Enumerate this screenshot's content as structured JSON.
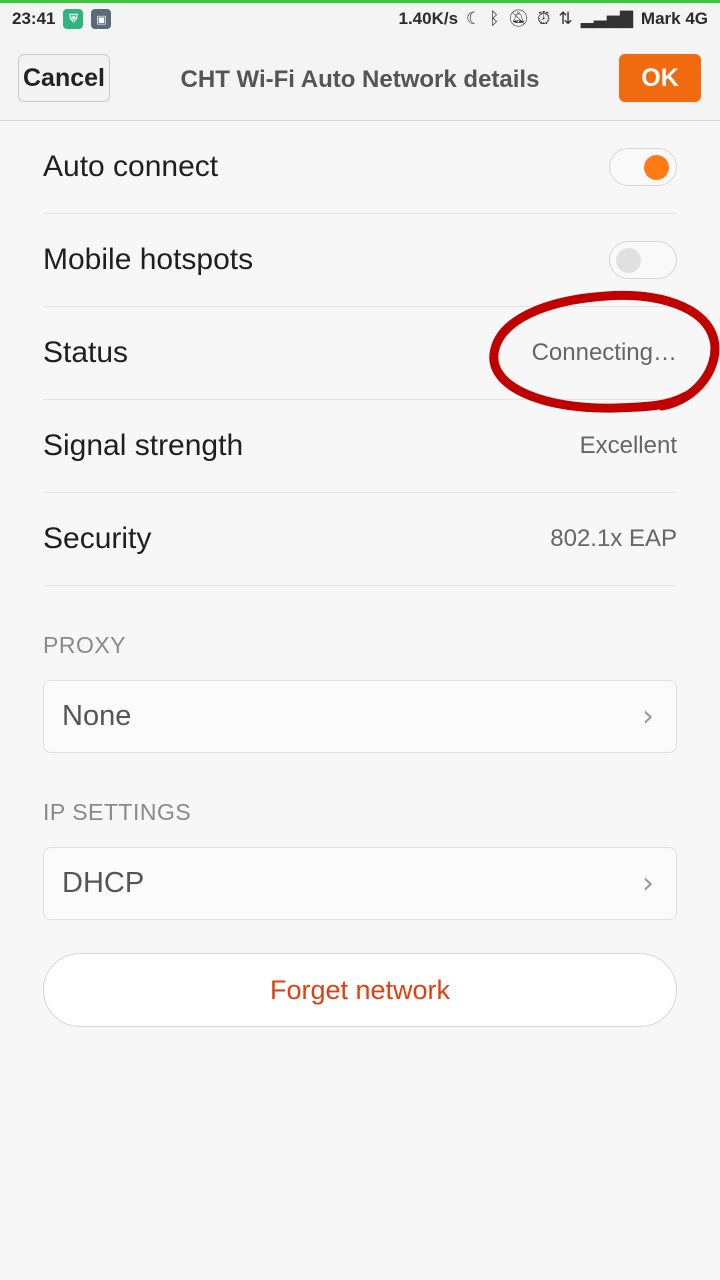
{
  "statusbar": {
    "time": "23:41",
    "speed": "1.40K/s",
    "carrier": "Mark 4G",
    "icons": [
      "shield-app-icon",
      "app-icon",
      "moon-icon",
      "bluetooth-icon",
      "mute-icon",
      "alarm-icon",
      "data-arrows-icon",
      "signal-icon"
    ]
  },
  "header": {
    "cancel_label": "Cancel",
    "title": "CHT Wi-Fi Auto Network details",
    "ok_label": "OK"
  },
  "rows": {
    "auto_connect": {
      "label": "Auto connect",
      "on": true
    },
    "mobile_hotspots": {
      "label": "Mobile hotspots",
      "on": false
    },
    "status": {
      "label": "Status",
      "value": "Connecting…"
    },
    "signal": {
      "label": "Signal strength",
      "value": "Excellent"
    },
    "security": {
      "label": "Security",
      "value": "802.1x EAP"
    }
  },
  "proxy": {
    "title": "PROXY",
    "value": "None"
  },
  "ip_settings": {
    "title": "IP SETTINGS",
    "value": "DHCP"
  },
  "forget_label": "Forget network",
  "colors": {
    "accent": "#f06a10",
    "toggle_on": "#ff7a14",
    "forget_text": "#e0400f",
    "annotation": "#c00000"
  }
}
